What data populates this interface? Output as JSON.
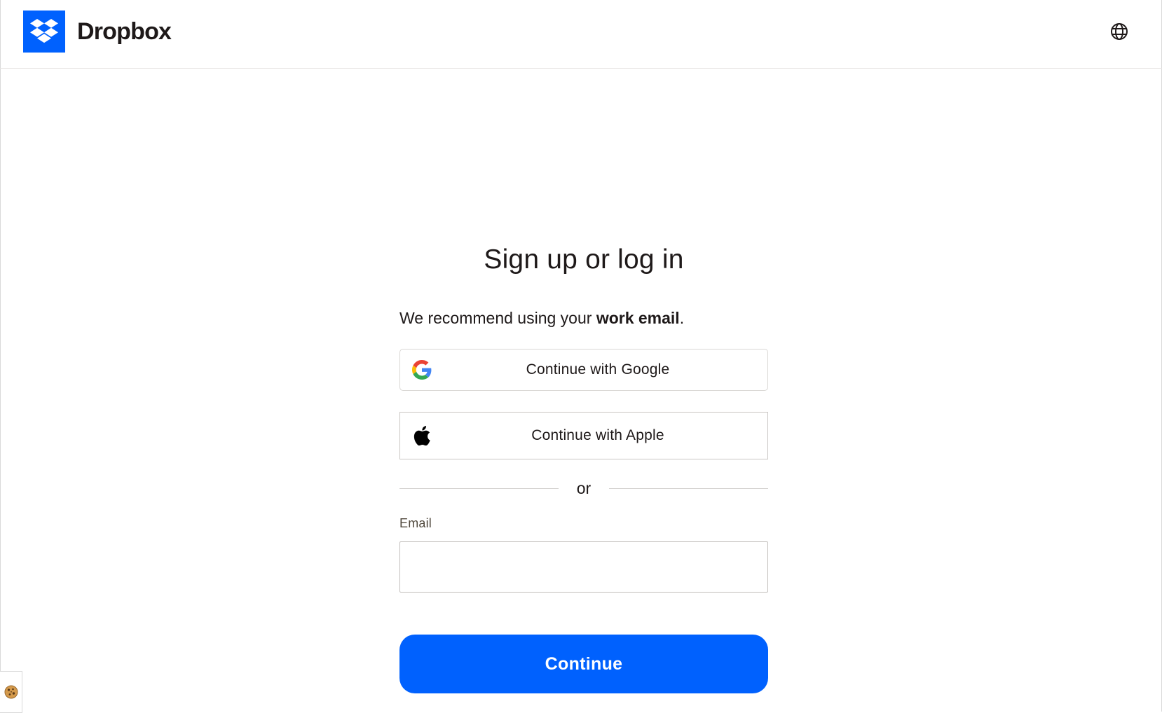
{
  "header": {
    "brand_name": "Dropbox",
    "logo_icon": "dropbox-logo-icon",
    "language_icon": "globe-icon"
  },
  "colors": {
    "brand_blue": "#0061fe",
    "text": "#1e1919",
    "border": "#d6d3d1"
  },
  "auth": {
    "title": "Sign up or log in",
    "subtitle_prefix": "We recommend using your ",
    "subtitle_bold": "work email",
    "subtitle_suffix": ".",
    "google_button_label": "Continue with Google",
    "google_icon": "google-g-icon",
    "apple_button_label": "Continue with Apple",
    "apple_icon": "apple-logo-icon",
    "divider_text": "or",
    "email_label": "Email",
    "email_value": "",
    "email_placeholder": "",
    "continue_label": "Continue"
  },
  "cookie": {
    "icon": "cookie-icon"
  }
}
